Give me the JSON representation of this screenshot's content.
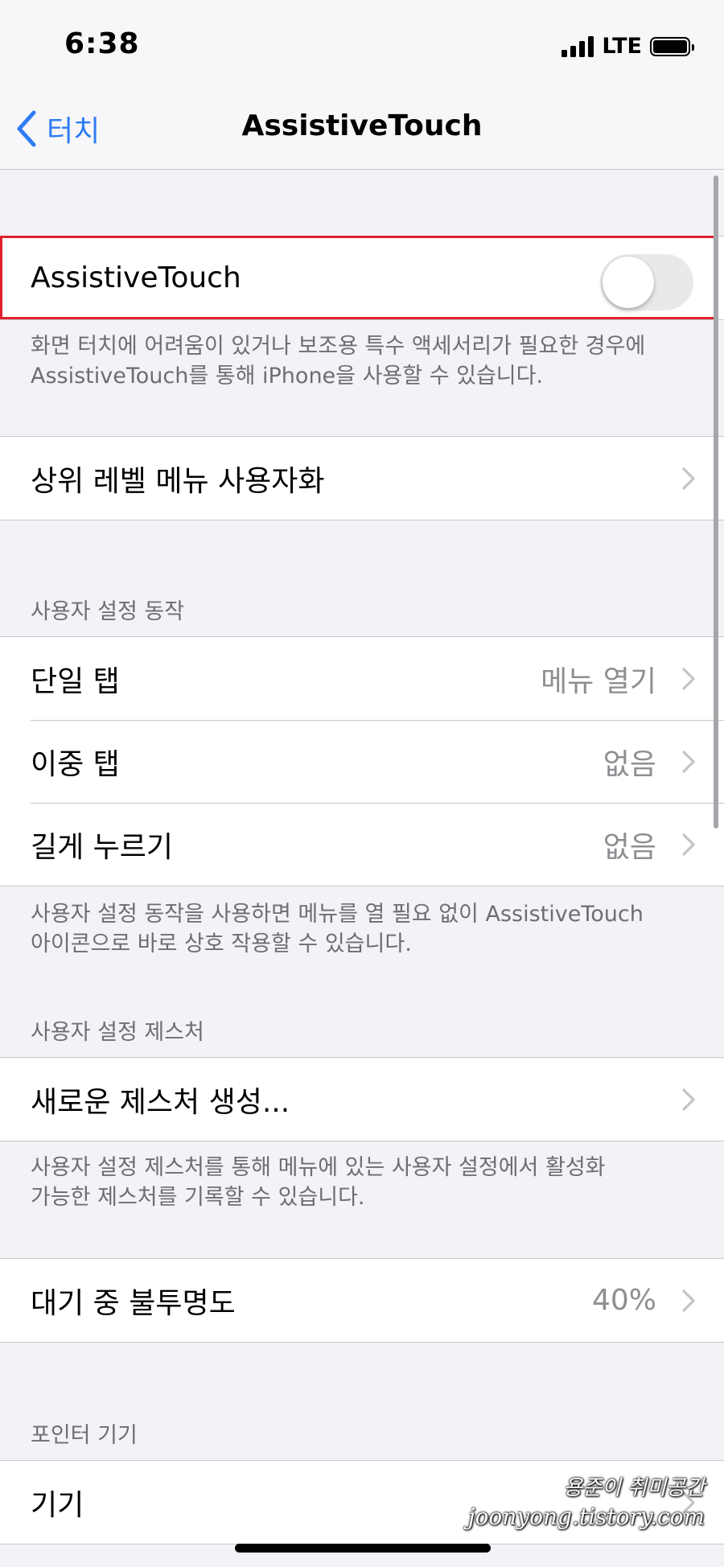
{
  "status_bar": {
    "time": "6:38",
    "network": "LTE"
  },
  "nav": {
    "back_label": "터치",
    "title": "AssistiveTouch"
  },
  "assistive_touch": {
    "label": "AssistiveTouch",
    "enabled": false,
    "footer": [
      "화면 터치에 어려움이 있거나 보조용 특수 액세서리가 필요한 경우에",
      "AssistiveTouch를 통해 iPhone을 사용할 수 있습니다."
    ]
  },
  "top_level_menu": {
    "label": "상위 레벨 메뉴 사용자화"
  },
  "custom_actions": {
    "header": "사용자 설정 동작",
    "items": [
      {
        "label": "단일 탭",
        "value": "메뉴 열기"
      },
      {
        "label": "이중 탭",
        "value": "없음"
      },
      {
        "label": "길게 누르기",
        "value": "없음"
      }
    ],
    "footer": [
      "사용자 설정 동작을 사용하면 메뉴를 열 필요 없이 AssistiveTouch",
      "아이콘으로 바로 상호 작용할 수 있습니다."
    ]
  },
  "custom_gestures": {
    "header": "사용자 설정 제스처",
    "create_label": "새로운 제스처 생성...",
    "footer": [
      "사용자 설정 제스처를 통해 메뉴에 있는 사용자 설정에서 활성화",
      "가능한 제스처를 기록할 수 있습니다."
    ]
  },
  "idle_opacity": {
    "label": "대기 중 불투명도",
    "value": "40%"
  },
  "pointer_devices": {
    "header": "포인터 기기",
    "devices_label": "기기"
  },
  "watermark": {
    "line1": "용준이 취미공간",
    "line2": "joonyong.tistory.com"
  },
  "colors": {
    "accent": "#2f7cf6",
    "highlight": "#e0222e",
    "background": "#f2f2f7"
  }
}
